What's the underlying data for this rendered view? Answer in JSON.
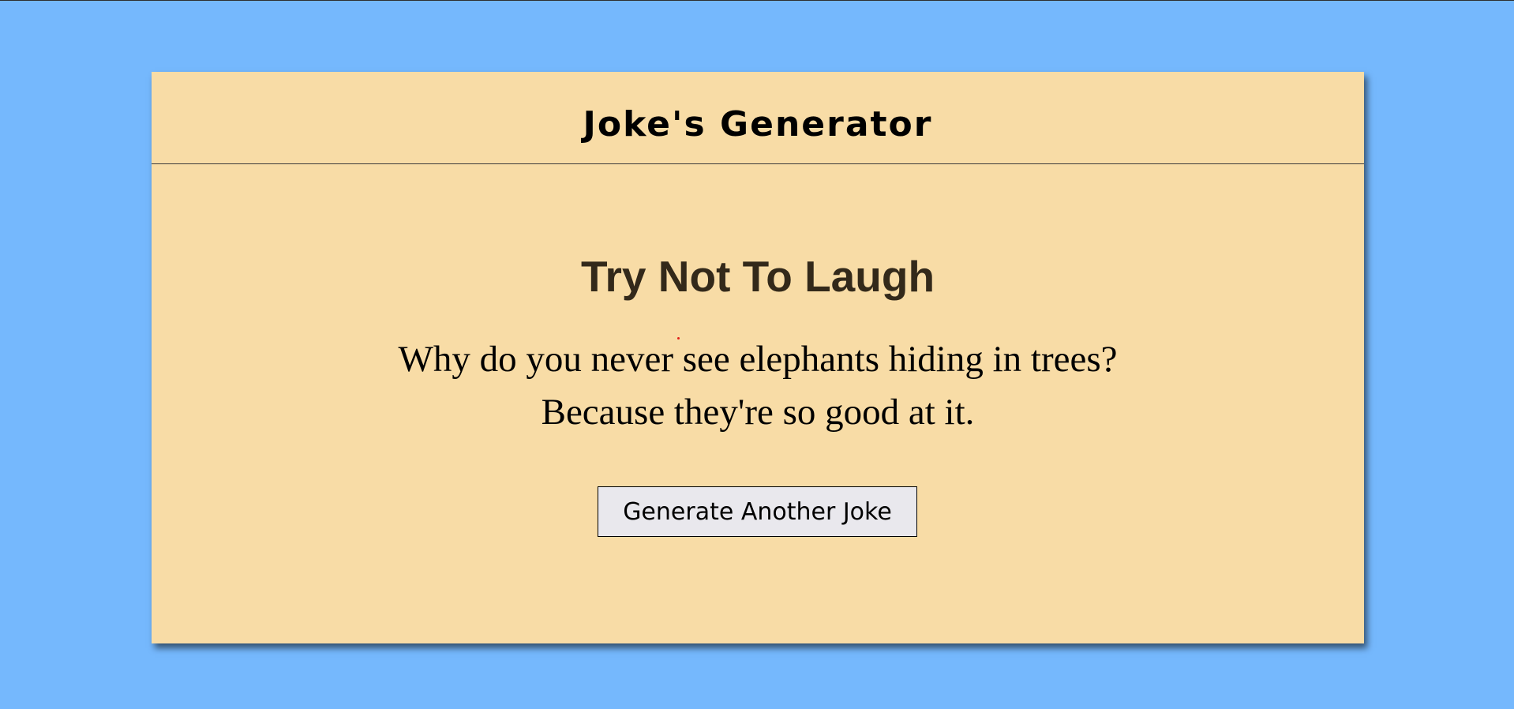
{
  "header": {
    "title": "Joke's Generator"
  },
  "main": {
    "headline": "Try Not To Laugh",
    "joke_setup": "Why do you never see elephants hiding in trees?",
    "joke_punchline": "Because they're so good at it.",
    "generate_button_label": "Generate Another Joke"
  },
  "colors": {
    "page_background": "#75b8fd",
    "card_background": "#f8dca6",
    "headline_color": "#33291a",
    "button_background": "#e9e8ed"
  }
}
